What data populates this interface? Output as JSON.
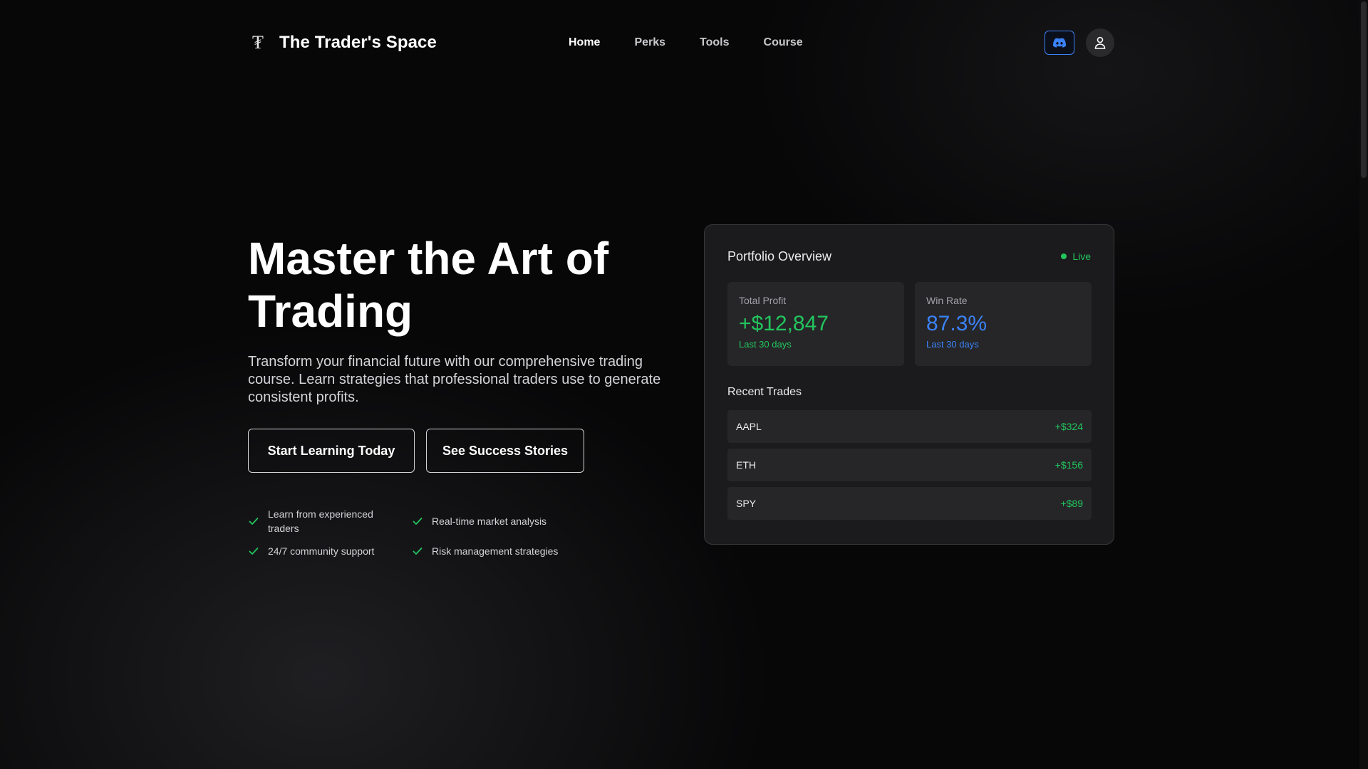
{
  "brand": {
    "logo_glyph": "₮",
    "name": "The Trader's Space"
  },
  "nav": {
    "links": [
      {
        "label": "Home",
        "active": true
      },
      {
        "label": "Perks",
        "active": false
      },
      {
        "label": "Tools",
        "active": false
      },
      {
        "label": "Course",
        "active": false
      }
    ],
    "discord_icon": "discord-icon",
    "user_icon": "user-icon"
  },
  "hero": {
    "title": "Master the Art of Trading",
    "description": "Transform your financial future with our comprehensive trading course. Learn strategies that professional traders use to generate consistent profits.",
    "primary_cta": "Start Learning Today",
    "secondary_cta": "See Success Stories",
    "features": [
      "Learn from experienced traders",
      "Real-time market analysis",
      "24/7 community support",
      "Risk management strategies"
    ]
  },
  "portfolio": {
    "title": "Portfolio Overview",
    "status": "Live",
    "stats": [
      {
        "label": "Total Profit",
        "value": "+$12,847",
        "sub": "Last 30 days",
        "color": "#22c55e"
      },
      {
        "label": "Win Rate",
        "value": "87.3%",
        "sub": "Last 30 days",
        "color": "#3b82f6"
      }
    ],
    "recent_label": "Recent Trades",
    "trades": [
      {
        "symbol": "AAPL",
        "pnl": "+$324"
      },
      {
        "symbol": "ETH",
        "pnl": "+$156"
      },
      {
        "symbol": "SPY",
        "pnl": "+$89"
      }
    ]
  },
  "colors": {
    "accent_green": "#22c55e",
    "accent_blue": "#3b82f6",
    "background": "#070708",
    "card": "#1b1b1d"
  }
}
